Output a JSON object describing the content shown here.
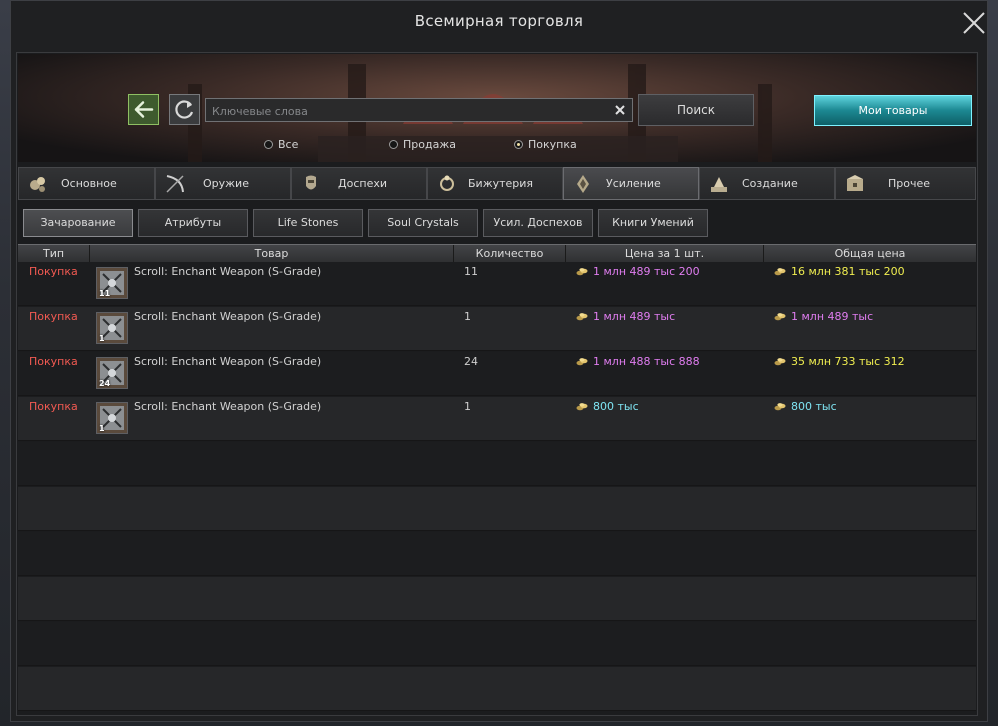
{
  "window": {
    "title": "Всемирная торговля"
  },
  "search": {
    "placeholder": "Ключевые слова",
    "value": "",
    "button_label": "Поиск",
    "my_goods_label": "Мои товары"
  },
  "filters": [
    {
      "label": "Все",
      "selected": false
    },
    {
      "label": "Продажа",
      "selected": false
    },
    {
      "label": "Покупка",
      "selected": true
    }
  ],
  "categories": [
    {
      "label": "Основное",
      "icon": "items-icon",
      "active": false
    },
    {
      "label": "Оружие",
      "icon": "weapon-icon",
      "active": false
    },
    {
      "label": "Доспехи",
      "icon": "armor-icon",
      "active": false
    },
    {
      "label": "Бижутерия",
      "icon": "jewelry-icon",
      "active": false
    },
    {
      "label": "Усиление",
      "icon": "enhance-icon",
      "active": true
    },
    {
      "label": "Создание",
      "icon": "crafting-icon",
      "active": false
    },
    {
      "label": "Прочее",
      "icon": "misc-icon",
      "active": false
    }
  ],
  "subcategories": [
    {
      "label": "Зачарование",
      "active": true
    },
    {
      "label": "Атрибуты",
      "active": false
    },
    {
      "label": "Life Stones",
      "active": false
    },
    {
      "label": "Soul Crystals",
      "active": false
    },
    {
      "label": "Усил. Доспехов",
      "active": false
    },
    {
      "label": "Книги Умений",
      "active": false
    }
  ],
  "table": {
    "columns": [
      "Тип",
      "Товар",
      "Количество",
      "Цена за 1 шт.",
      "Общая цена"
    ],
    "rows": [
      {
        "type": "Покупка",
        "item": "Scroll: Enchant Weapon (S-Grade)",
        "icon_qty": "11",
        "quantity": "11",
        "price": "1 млн 489 тыс 200",
        "price_color": "#e07df0",
        "total": "16 млн 381 тыс 200",
        "total_color": "#f0ee50"
      },
      {
        "type": "Покупка",
        "item": "Scroll: Enchant Weapon (S-Grade)",
        "icon_qty": "1",
        "quantity": "1",
        "price": "1 млн 489 тыс",
        "price_color": "#e07df0",
        "total": "1 млн 489 тыс",
        "total_color": "#e07df0"
      },
      {
        "type": "Покупка",
        "item": "Scroll: Enchant Weapon (S-Grade)",
        "icon_qty": "24",
        "quantity": "24",
        "price": "1 млн 488 тыс 888",
        "price_color": "#e07df0",
        "total": "35 млн 733 тыс 312",
        "total_color": "#f0ee50"
      },
      {
        "type": "Покупка",
        "item": "Scroll: Enchant Weapon (S-Grade)",
        "icon_qty": "1",
        "quantity": "1",
        "price": "800 тыс",
        "price_color": "#7ee3f1",
        "total": "800 тыс",
        "total_color": "#7ee3f1"
      }
    ]
  },
  "colors": {
    "buy_type": "#f25a52",
    "accent_button": "#1c8892"
  }
}
